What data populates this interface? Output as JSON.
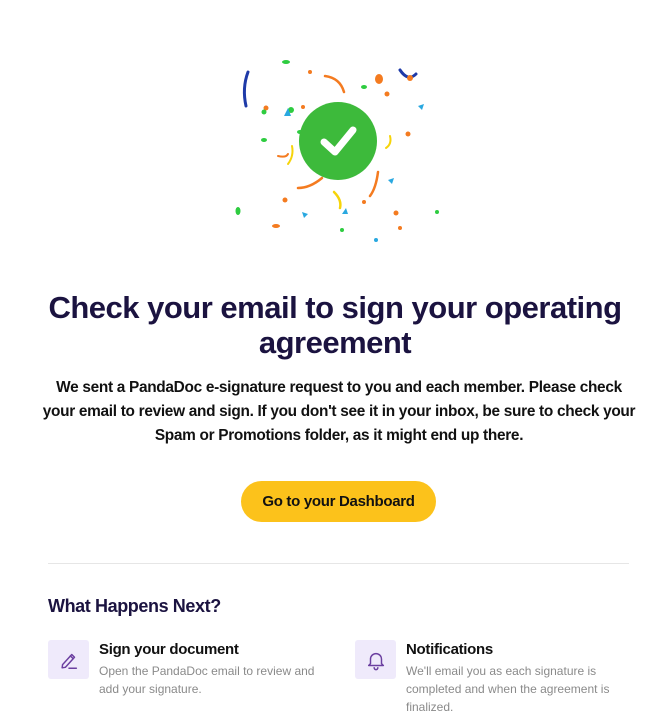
{
  "hero": {
    "icon": "checkmark-icon",
    "decoration": "confetti",
    "colors": {
      "check_circle": "#3dba3b",
      "confetti": [
        "#f47b20",
        "#2ecc40",
        "#29a8e0",
        "#1e3aa8",
        "#f6d40a"
      ]
    }
  },
  "main": {
    "title": "Check your email to sign your operating agreement",
    "body": "We sent a PandaDoc e-signature request to you and each member. Please check your email to review and sign. If you don't see it in your inbox, be sure to check your Spam or Promotions folder, as it might end up there.",
    "cta_label": "Go to your Dashboard"
  },
  "next": {
    "heading": "What Happens Next?",
    "steps": [
      {
        "icon": "pen-icon",
        "title": "Sign your document",
        "description": "Open the PandaDoc email to review and add your signature."
      },
      {
        "icon": "bell-icon",
        "title": "Notifications",
        "description": "We'll email you as each signature is completed and when the agreement is finalized."
      }
    ]
  },
  "colors": {
    "accent": "#fcc21b",
    "heading": "#1b1340",
    "icon_bg": "#efeafb",
    "icon_stroke": "#6b3fa0"
  }
}
